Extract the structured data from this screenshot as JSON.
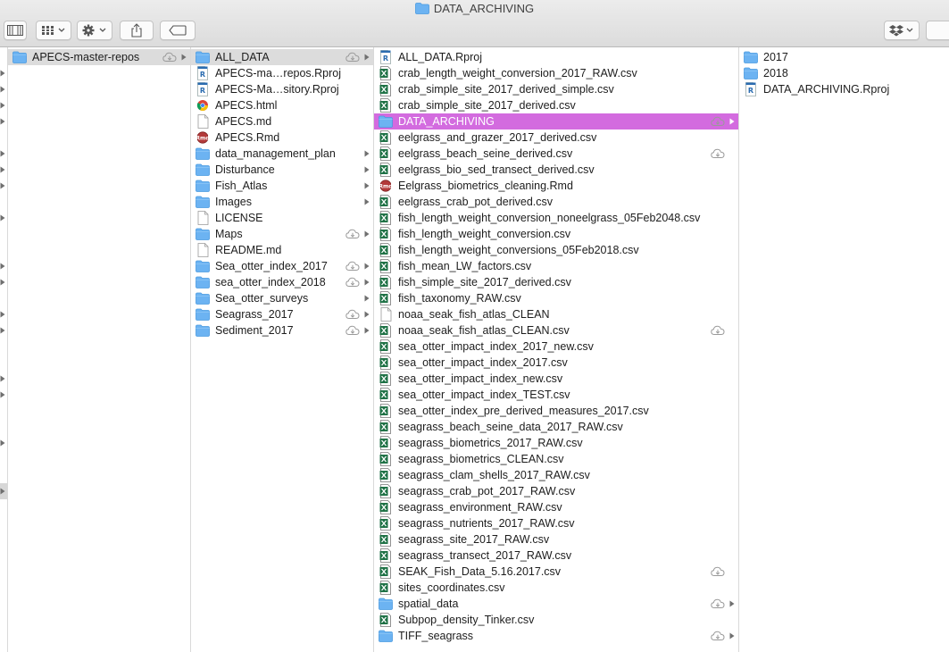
{
  "window": {
    "title": "DATA_ARCHIVING"
  },
  "toolbar": {
    "view_button": "view-columns-icon",
    "arrange_button": "arrange-grid-icon",
    "action_button": "gear-icon",
    "share_button": "share-icon",
    "tags_button": "tag-icon",
    "dropbox_button": "dropbox-icon"
  },
  "colors": {
    "folder": "#6cb3f2",
    "selection_active": "#d36bdf",
    "selection_inactive": "#dcdcdc",
    "excel": "#1e7145"
  },
  "column1": [
    {
      "name": "APECS-master-repos",
      "type": "folder",
      "cloud": true,
      "arrow": true,
      "selected": true
    }
  ],
  "column2": [
    {
      "name": "ALL_DATA",
      "type": "folder",
      "cloud": true,
      "arrow": true,
      "selected": true
    },
    {
      "name": "APECS-ma…repos.Rproj",
      "type": "rproj"
    },
    {
      "name": "APECS-Ma…sitory.Rproj",
      "type": "rproj"
    },
    {
      "name": "APECS.html",
      "type": "html"
    },
    {
      "name": "APECS.md",
      "type": "doc"
    },
    {
      "name": "APECS.Rmd",
      "type": "rmd"
    },
    {
      "name": "data_management_plan",
      "type": "folder",
      "arrow": true
    },
    {
      "name": "Disturbance",
      "type": "folder",
      "arrow": true
    },
    {
      "name": "Fish_Atlas",
      "type": "folder",
      "arrow": true
    },
    {
      "name": "Images",
      "type": "folder",
      "arrow": true
    },
    {
      "name": "LICENSE",
      "type": "doc"
    },
    {
      "name": "Maps",
      "type": "folder",
      "cloud": true,
      "arrow": true
    },
    {
      "name": "README.md",
      "type": "doc"
    },
    {
      "name": "Sea_otter_index_2017",
      "type": "folder",
      "cloud": true,
      "arrow": true
    },
    {
      "name": "sea_otter_index_2018",
      "type": "folder",
      "cloud": true,
      "arrow": true
    },
    {
      "name": "Sea_otter_surveys",
      "type": "folder",
      "arrow": true
    },
    {
      "name": "Seagrass_2017",
      "type": "folder",
      "cloud": true,
      "arrow": true
    },
    {
      "name": "Sediment_2017",
      "type": "folder",
      "cloud": true,
      "arrow": true
    }
  ],
  "column3": [
    {
      "name": "ALL_DATA.Rproj",
      "type": "rproj"
    },
    {
      "name": "crab_length_weight_conversion_2017_RAW.csv",
      "type": "csv"
    },
    {
      "name": "crab_simple_site_2017_derived_simple.csv",
      "type": "csv"
    },
    {
      "name": "crab_simple_site_2017_derived.csv",
      "type": "csv"
    },
    {
      "name": "DATA_ARCHIVING",
      "type": "folder",
      "cloud": true,
      "arrow": true,
      "selected": true
    },
    {
      "name": "eelgrass_and_grazer_2017_derived.csv",
      "type": "csv"
    },
    {
      "name": "eelgrass_beach_seine_derived.csv",
      "type": "csv",
      "cloud": true
    },
    {
      "name": "eelgrass_bio_sed_transect_derived.csv",
      "type": "csv"
    },
    {
      "name": "Eelgrass_biometrics_cleaning.Rmd",
      "type": "rmd"
    },
    {
      "name": "eelgrass_crab_pot_derived.csv",
      "type": "csv"
    },
    {
      "name": "fish_length_weight_conversion_noneelgrass_05Feb2048.csv",
      "type": "csv"
    },
    {
      "name": "fish_length_weight_conversion.csv",
      "type": "csv"
    },
    {
      "name": "fish_length_weight_conversions_05Feb2018.csv",
      "type": "csv"
    },
    {
      "name": "fish_mean_LW_factors.csv",
      "type": "csv"
    },
    {
      "name": "fish_simple_site_2017_derived.csv",
      "type": "csv"
    },
    {
      "name": "fish_taxonomy_RAW.csv",
      "type": "csv"
    },
    {
      "name": "noaa_seak_fish_atlas_CLEAN",
      "type": "doc"
    },
    {
      "name": "noaa_seak_fish_atlas_CLEAN.csv",
      "type": "csv",
      "cloud": true
    },
    {
      "name": "sea_otter_impact_index_2017_new.csv",
      "type": "csv"
    },
    {
      "name": "sea_otter_impact_index_2017.csv",
      "type": "csv"
    },
    {
      "name": "sea_otter_impact_index_new.csv",
      "type": "csv"
    },
    {
      "name": "sea_otter_impact_index_TEST.csv",
      "type": "csv"
    },
    {
      "name": "sea_otter_index_pre_derived_measures_2017.csv",
      "type": "csv"
    },
    {
      "name": "seagrass_beach_seine_data_2017_RAW.csv",
      "type": "csv"
    },
    {
      "name": "seagrass_biometrics_2017_RAW.csv",
      "type": "csv"
    },
    {
      "name": "seagrass_biometrics_CLEAN.csv",
      "type": "csv"
    },
    {
      "name": "seagrass_clam_shells_2017_RAW.csv",
      "type": "csv"
    },
    {
      "name": "seagrass_crab_pot_2017_RAW.csv",
      "type": "csv"
    },
    {
      "name": "seagrass_environment_RAW.csv",
      "type": "csv"
    },
    {
      "name": "seagrass_nutrients_2017_RAW.csv",
      "type": "csv"
    },
    {
      "name": "seagrass_site_2017_RAW.csv",
      "type": "csv"
    },
    {
      "name": "seagrass_transect_2017_RAW.csv",
      "type": "csv"
    },
    {
      "name": "SEAK_Fish_Data_5.16.2017.csv",
      "type": "csv",
      "cloud": true
    },
    {
      "name": "sites_coordinates.csv",
      "type": "csv"
    },
    {
      "name": "spatial_data",
      "type": "folder",
      "cloud": true,
      "arrow": true
    },
    {
      "name": "Subpop_density_Tinker.csv",
      "type": "csv"
    },
    {
      "name": "TIFF_seagrass",
      "type": "folder",
      "cloud": true,
      "arrow": true
    }
  ],
  "column4": [
    {
      "name": "2017",
      "type": "folder"
    },
    {
      "name": "2018",
      "type": "folder"
    },
    {
      "name": "DATA_ARCHIVING.Rproj",
      "type": "rproj"
    }
  ],
  "left_edge_markers": [
    1,
    2,
    3,
    4,
    6,
    7,
    8,
    10,
    13,
    14,
    16,
    17,
    20,
    21,
    24,
    27
  ]
}
